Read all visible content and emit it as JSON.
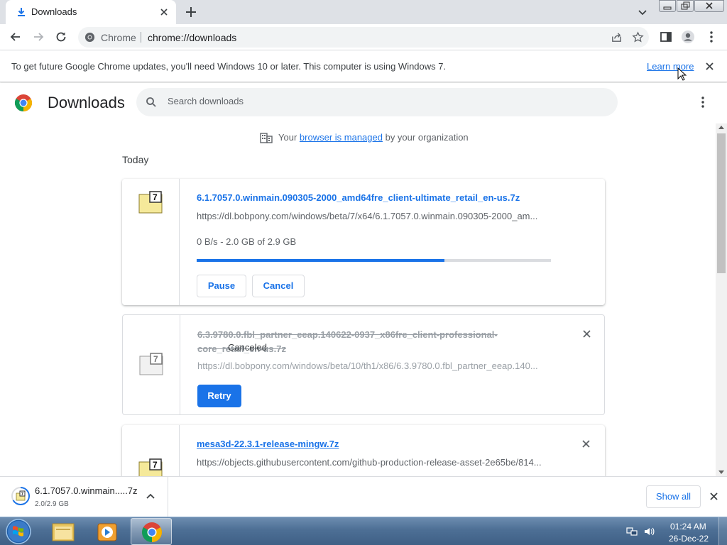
{
  "tab": {
    "title": "Downloads",
    "icon": "download-icon"
  },
  "omnibox": {
    "site_label": "Chrome",
    "url": "chrome://downloads"
  },
  "infobar": {
    "message": "To get future Google Chrome updates, you'll need Windows 10 or later. This computer is using Windows 7.",
    "link": "Learn more"
  },
  "page": {
    "title": "Downloads",
    "search_placeholder": "Search downloads",
    "managed_prefix": "Your",
    "managed_link": "browser is managed",
    "managed_suffix": "by your organization",
    "section_date": "Today"
  },
  "downloads": [
    {
      "name": "6.1.7057.0.winmain.090305-2000_amd64fre_client-ultimate_retail_en-us.7z",
      "url": "https://dl.bobpony.com/windows/beta/7/x64/6.1.7057.0.winmain.090305-2000_am...",
      "status": "0 B/s - 2.0 GB of 2.9 GB",
      "progress": 0.7,
      "pause_label": "Pause",
      "cancel_label": "Cancel"
    },
    {
      "name": "6.3.9780.0.fbl_partner_eeap.140622-0937_x86fre_client-professional-core_retail_en-us.7z",
      "status": "Canceled",
      "url": "https://dl.bobpony.com/windows/beta/10/th1/x86/6.3.9780.0.fbl_partner_eeap.140...",
      "retry_label": "Retry"
    },
    {
      "name": "mesa3d-22.3.1-release-mingw.7z",
      "url": "https://objects.githubusercontent.com/github-production-release-asset-2e65be/814..."
    }
  ],
  "shelf": {
    "name": "6.1.7057.0.winmain.....7z",
    "size": "2.0/2.9 GB",
    "show_all": "Show all"
  },
  "taskbar": {
    "time": "01:24 AM",
    "date": "26-Dec-22"
  },
  "colors": {
    "accent": "#1a73e8",
    "tabstrip": "#dee1e6"
  }
}
